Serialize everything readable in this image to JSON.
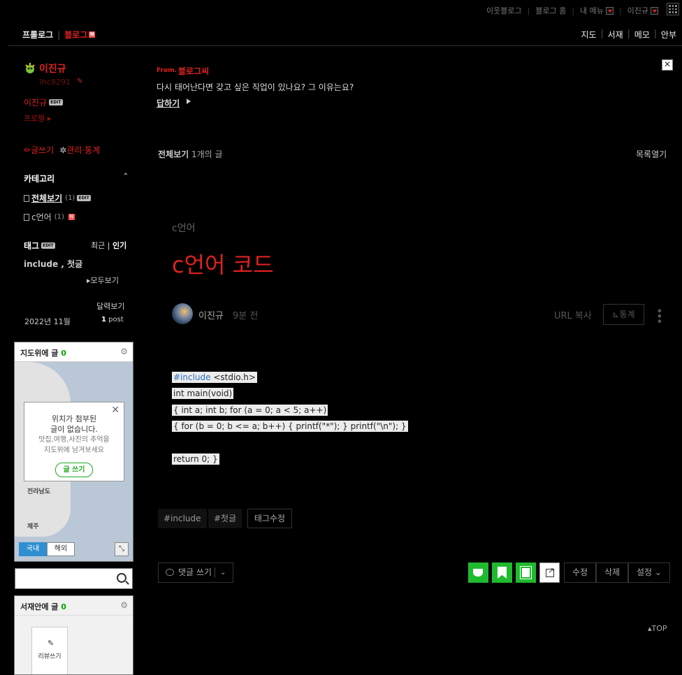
{
  "gnb": {
    "links": [
      "이웃블로그",
      "블로그 홈",
      "내 메뉴",
      "이진규"
    ]
  },
  "menu": {
    "prologue": "프롤로그",
    "blog": "블로그",
    "new_badge": "N",
    "right": [
      "지도",
      "서재",
      "메모",
      "안부"
    ]
  },
  "profile": {
    "nickname": "이진규",
    "user_id": "lhc8291",
    "name": "이진규",
    "edit_badge": "EDIT",
    "profile_link": "프로필",
    "write": "글쓰기",
    "admin": "관리·통계"
  },
  "category": {
    "title": "카테고리",
    "items": [
      {
        "label": "전체보기",
        "count": "(1)",
        "badge": "EDIT"
      },
      {
        "label": "c언어",
        "count": "(1)",
        "badge": "N"
      }
    ]
  },
  "tags": {
    "title": "태그",
    "edit_badge": "EDIT",
    "recent": "최근",
    "popular": "인기",
    "list": "include , 첫글",
    "all": "모두보기"
  },
  "calendar": {
    "link": "달력보기",
    "date": "2022년 11월",
    "post_count": "1",
    "post_label": "post"
  },
  "map_widget": {
    "title": "지도위에 글",
    "count": "0",
    "popup_line1": "위치가 첨부된",
    "popup_line2": "글이 없습니다.",
    "popup_sub1": "맛집,여행,사진의 추억을",
    "popup_sub2": "지도위에 남겨보세요",
    "write_button": "글 쓰기",
    "place1": "전라남도",
    "place2": "제주",
    "tab_domestic": "국내",
    "tab_overseas": "해외"
  },
  "search": {
    "placeholder": ""
  },
  "shelf_widget": {
    "title": "서재안에 글",
    "count": "0",
    "review": "리뷰쓰기"
  },
  "banner": {
    "from_label": "From.",
    "from_name": "블로그씨",
    "question": "다시 태어난다면 갖고 싶은 직업이 있나요? 그 이유는요?",
    "answer": "답하기"
  },
  "post_list": {
    "title": "전체보기",
    "count": "1개의 글",
    "open": "목록열기"
  },
  "post": {
    "category": "c언어",
    "title": "c언어 코드",
    "author": "이진규",
    "time": "9분 전",
    "url_copy": "URL 복사",
    "stats": "통계",
    "code": {
      "line1_kw": "#include",
      "line1_rest": " <stdio.h>",
      "line2": " int main(void)",
      "line3": "{ int a; int b; for (a = 0; a < 5; a++)",
      "line4": "{ for (b = 0; b <= a; b++) { printf(\"*\"); } printf(\"\\n\"); }",
      "line5": "return 0; }"
    },
    "tags": [
      "#include",
      "#첫글"
    ],
    "tag_edit": "태그수정",
    "comment": "댓글 쓰기",
    "edit": "수정",
    "delete": "삭제",
    "settings": "설정"
  },
  "top": "TOP"
}
